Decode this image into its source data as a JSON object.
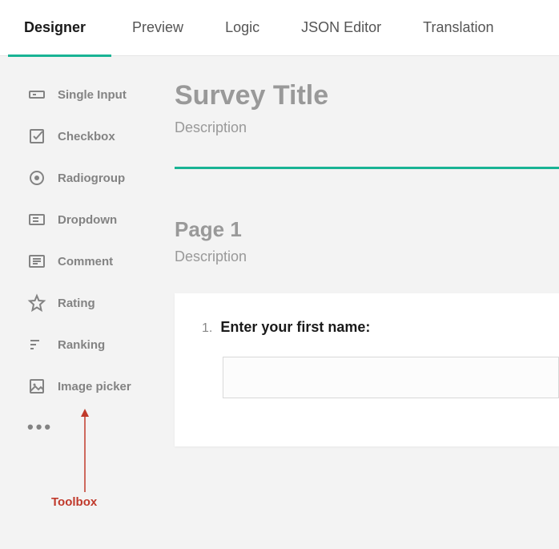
{
  "tabs": {
    "designer": "Designer",
    "preview": "Preview",
    "logic": "Logic",
    "json": "JSON Editor",
    "translation": "Translation"
  },
  "toolbox": {
    "single_input": "Single Input",
    "checkbox": "Checkbox",
    "radiogroup": "Radiogroup",
    "dropdown": "Dropdown",
    "comment": "Comment",
    "rating": "Rating",
    "ranking": "Ranking",
    "image_picker": "Image picker"
  },
  "survey": {
    "title": "Survey Title",
    "description": "Description"
  },
  "page": {
    "title": "Page 1",
    "description": "Description"
  },
  "question": {
    "number": "1.",
    "text": "Enter your first name:"
  },
  "annotation": {
    "label": "Toolbox"
  }
}
